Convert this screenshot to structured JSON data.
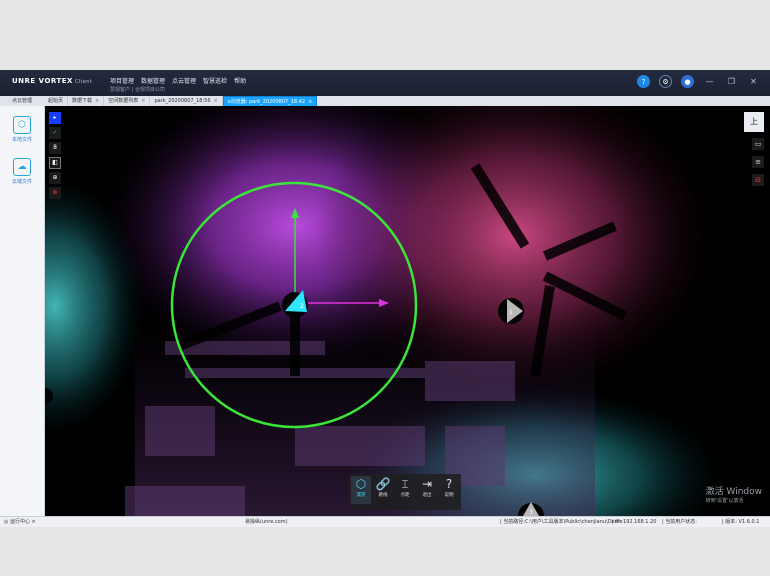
{
  "app": {
    "logo": "UNRE VORTEX",
    "logo_suffix": "Client",
    "company": "慧视客户 | 合规项目公司",
    "menu": [
      "项目管理",
      "数据管理",
      "点云管理",
      "智慧巡检",
      "帮助"
    ],
    "icons": [
      "help-icon",
      "gear-icon",
      "user-icon"
    ],
    "window_controls": [
      "—",
      "❐",
      "✕"
    ]
  },
  "sidebar": {
    "title": "点云管理",
    "items": [
      {
        "label": "本地文件",
        "icon": "cube-icon"
      },
      {
        "label": "云端文件",
        "icon": "cloud-icon"
      }
    ]
  },
  "tabs": [
    {
      "label": "起始页",
      "active": false
    },
    {
      "label": "数据下载",
      "active": false
    },
    {
      "label": "空间数据列表",
      "active": false
    },
    {
      "label": "park_20200807_18:56",
      "active": false
    },
    {
      "label": "e浏览器: park_20200807_18:42",
      "active": true
    }
  ],
  "viewport": {
    "left_tools": [
      "▸",
      "✓",
      "8",
      "◧",
      "⊕",
      "⊗"
    ],
    "up_button": "上",
    "right_buttons": [
      "▭",
      "≡",
      "⊟"
    ],
    "markers": [
      "2",
      "1",
      "3"
    ],
    "bottom_tools": [
      {
        "label": "漫游",
        "glyph": "⬡",
        "active": true
      },
      {
        "label": "路线",
        "glyph": "🔗",
        "active": false
      },
      {
        "label": "点距",
        "glyph": "⌶",
        "active": false
      },
      {
        "label": "退出",
        "glyph": "⇥",
        "active": false
      },
      {
        "label": "说明",
        "glyph": "?",
        "active": false
      }
    ],
    "activation_line1": "激活 Window",
    "activation_line2": "转到'设置'以激活"
  },
  "statusbar": {
    "left": "◎ 运行中心 ×",
    "center": "易操纵(unre.com)",
    "path": "| 当前路径:C:\\用户\\工具版本\\Public\\chenjianu\\Demo",
    "ip": "| IP: 192.168.1.20",
    "status": "| 当前用户状态:",
    "version": "| 版本: V1.6.0.1"
  },
  "colors": {
    "accent": "#1aa3ff",
    "ring": "#39e639",
    "magenta_cloud": "#b040d8",
    "pink_cloud": "#d44a8a",
    "cyan_cloud": "#3cc6c6"
  }
}
